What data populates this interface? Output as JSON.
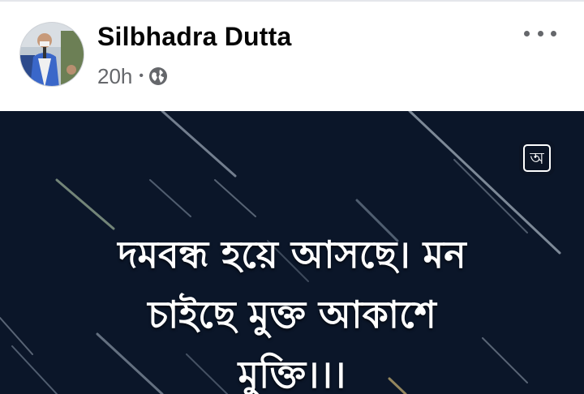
{
  "author": {
    "name": "Silbhadra Dutta",
    "time": "20h",
    "separator": "•",
    "privacy_icon": "globe-icon"
  },
  "menu": {
    "icon": "more-options-icon"
  },
  "image": {
    "translate_glyph": "অ",
    "quote_lines": [
      "দমবন্ধ হয়ে আসছে। মন",
      "চাইছে মুক্ত আকাশে",
      "মুক্তি।।।"
    ]
  },
  "colors": {
    "name_text": "#050505",
    "meta_text": "#65676b",
    "image_background": "#0b1629",
    "quote_text": "#ffffff"
  }
}
